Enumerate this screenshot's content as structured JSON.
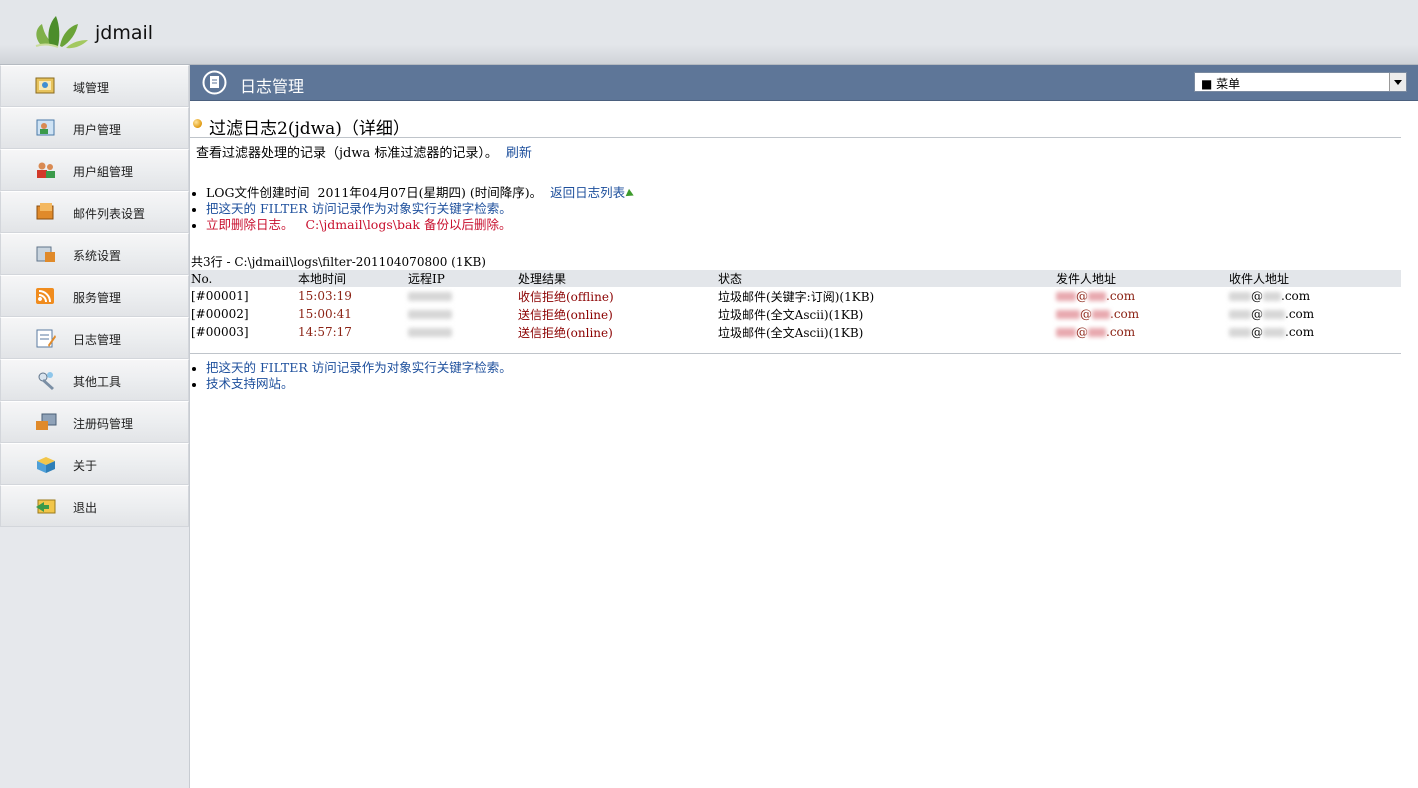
{
  "app": {
    "brand": "jdmail"
  },
  "sidebar": {
    "items": [
      {
        "label": "域管理",
        "icon": "domain-icon"
      },
      {
        "label": "用户管理",
        "icon": "user-icon"
      },
      {
        "label": "用户組管理",
        "icon": "user-group-icon"
      },
      {
        "label": "邮件列表设置",
        "icon": "mailing-list-icon"
      },
      {
        "label": "系统设置",
        "icon": "system-settings-icon"
      },
      {
        "label": "服务管理",
        "icon": "service-icon"
      },
      {
        "label": "日志管理",
        "icon": "log-icon"
      },
      {
        "label": "其他工具",
        "icon": "tools-icon"
      },
      {
        "label": "注册码管理",
        "icon": "registration-icon"
      },
      {
        "label": "关于",
        "icon": "about-icon"
      },
      {
        "label": "退出",
        "icon": "logout-icon"
      }
    ]
  },
  "titlebar": {
    "title": "日志管理",
    "menu_value": "■ 菜单"
  },
  "page": {
    "heading": "过滤日志2(jdwa)（详细）",
    "subtitle": "查看过滤器处理的记录（jdwa 标准过滤器的记录）。",
    "refresh": "刷新",
    "log_created_prefix": "LOG文件创建时间",
    "log_created_date": "2011年04月07日(星期四) (时间降序)。",
    "back_link": "返回日志列表",
    "search_link": "把这天的 FILTER 访问记录作为对象实行关键字检索。",
    "delete_link": "立即删除日志。",
    "delete_note": "C:\\jdmail\\logs\\bak 备份以后删除。",
    "summary": "共3行  - C:\\jdmail\\logs\\filter-201104070800 (1KB)"
  },
  "table": {
    "headers": [
      "No.",
      "本地时间",
      "远程IP",
      "处理结果",
      "状态",
      "发件人地址",
      "收件人地址"
    ],
    "rows": [
      {
        "no": "[#00001]",
        "time": "15:03:19",
        "result": "收信拒绝(offline)",
        "status": "垃圾邮件(关键字:订阅)(1KB)",
        "from_domain": ".com",
        "to_domain": ".com"
      },
      {
        "no": "[#00002]",
        "time": "15:00:41",
        "result": "送信拒绝(online)",
        "status": "垃圾邮件(全文Ascii)(1KB)",
        "from_domain": ".com",
        "to_domain": ".com"
      },
      {
        "no": "[#00003]",
        "time": "14:57:17",
        "result": "送信拒绝(online)",
        "status": "垃圾邮件(全文Ascii)(1KB)",
        "from_domain": ".com",
        "to_domain": ".com"
      }
    ]
  },
  "footer": {
    "search_link": "把这天的 FILTER 访问记录作为对象实行关键字检索。",
    "support_link": "技术支持网站。"
  },
  "colors": {
    "titlebar": "#5e7698",
    "link": "#1d4f9c",
    "danger": "#c8102e"
  }
}
